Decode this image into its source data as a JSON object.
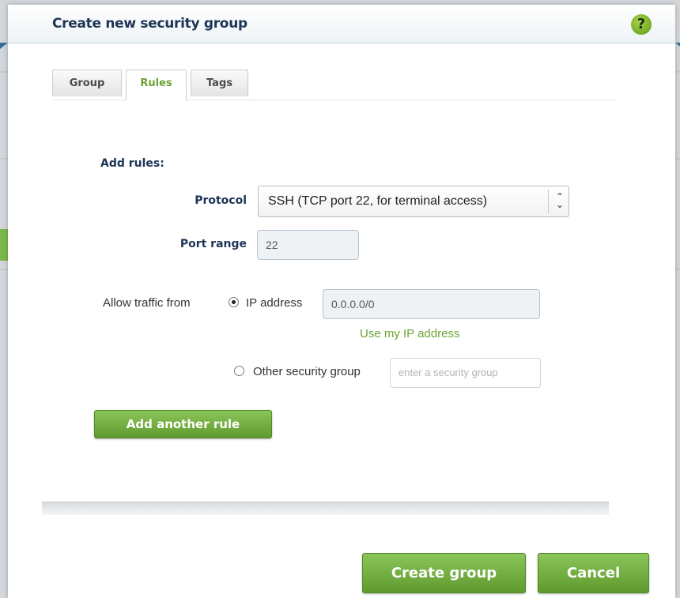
{
  "dialog": {
    "title": "Create new security group",
    "help_icon": "question-icon"
  },
  "tabs": [
    {
      "label": "Group",
      "active": false
    },
    {
      "label": "Rules",
      "active": true
    },
    {
      "label": "Tags",
      "active": false
    }
  ],
  "rules": {
    "section_label": "Add rules:",
    "protocol_label": "Protocol",
    "protocol_value": "SSH (TCP port 22, for terminal access)",
    "port_label": "Port range",
    "port_value": "22",
    "allow_label": "Allow traffic from",
    "ip_option_label": "IP address",
    "ip_value": "0.0.0.0/0",
    "use_my_ip_link": "Use my IP address",
    "sg_option_label": "Other security group",
    "sg_placeholder": "enter a security group",
    "add_rule_label": "Add another rule"
  },
  "footer": {
    "create_label": "Create group",
    "cancel_label": "Cancel"
  },
  "colors": {
    "accent_green": "#6aa332",
    "title_navy": "#1d3556"
  }
}
